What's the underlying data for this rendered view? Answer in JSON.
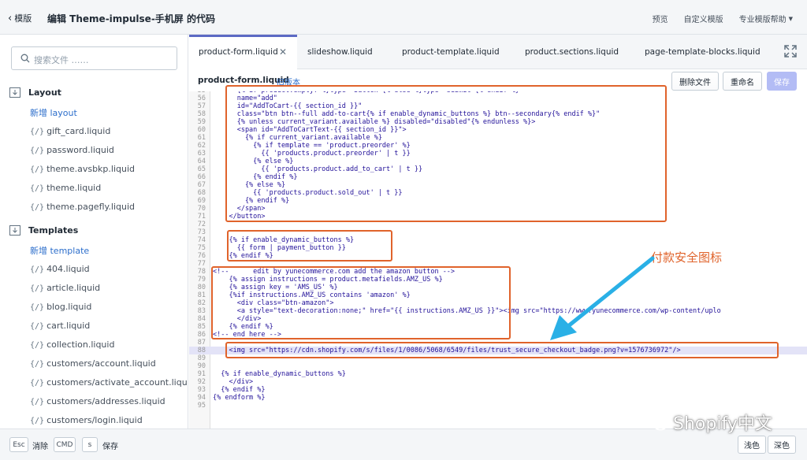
{
  "topbar": {
    "back_label": "模版",
    "title": "编辑 Theme-impulse-手机屏 的代码",
    "nav": [
      "预览",
      "自定义模版",
      "专业模版帮助"
    ]
  },
  "sidebar": {
    "search_placeholder": "搜索文件 ……",
    "layout": {
      "heading": "Layout",
      "new_label": "新增 layout",
      "files": [
        "gift_card.liquid",
        "password.liquid",
        "theme.avsbkp.liquid",
        "theme.liquid",
        "theme.pagefly.liquid"
      ]
    },
    "templates": {
      "heading": "Templates",
      "new_label": "新增 template",
      "files": [
        "404.liquid",
        "article.liquid",
        "blog.liquid",
        "cart.liquid",
        "collection.liquid",
        "customers/account.liquid",
        "customers/activate_account.liquid",
        "customers/addresses.liquid",
        "customers/login.liquid"
      ]
    },
    "file_prefix": "{/}"
  },
  "tabs": [
    "product-form.liquid",
    "slideshow.liquid",
    "product-template.liquid",
    "product.sections.liquid",
    "page-template-blocks.liquid"
  ],
  "file_header": {
    "name": "product-form.liquid",
    "old_version": "旧版本",
    "delete_label": "删除文件",
    "rename_label": "重命名",
    "save_label": "保存"
  },
  "code_lines": [
    {
      "n": "55",
      "t": "      {% if product.empty? %}type=\"button\"{% else %}type=\"submit\"{% endif %}"
    },
    {
      "n": "56",
      "t": "      name=\"add\""
    },
    {
      "n": "57",
      "t": "      id=\"AddToCart-{{ section_id }}\""
    },
    {
      "n": "58",
      "t": "      class=\"btn btn--full add-to-cart{% if enable_dynamic_buttons %} btn--secondary{% endif %}\""
    },
    {
      "n": "59",
      "t": "      {% unless current_variant.available %} disabled=\"disabled\"{% endunless %}>"
    },
    {
      "n": "60",
      "t": "      <span id=\"AddToCartText-{{ section_id }}\">"
    },
    {
      "n": "61",
      "t": "        {% if current_variant.available %}"
    },
    {
      "n": "62",
      "t": "          {% if template == 'product.preorder' %}"
    },
    {
      "n": "63",
      "t": "            {{ 'products.product.preorder' | t }}"
    },
    {
      "n": "64",
      "t": "          {% else %}"
    },
    {
      "n": "65",
      "t": "            {{ 'products.product.add_to_cart' | t }}"
    },
    {
      "n": "66",
      "t": "          {% endif %}"
    },
    {
      "n": "67",
      "t": "        {% else %}"
    },
    {
      "n": "68",
      "t": "          {{ 'products.product.sold_out' | t }}"
    },
    {
      "n": "69",
      "t": "        {% endif %}"
    },
    {
      "n": "70",
      "t": "      </span>"
    },
    {
      "n": "71",
      "t": "    </button>"
    },
    {
      "n": "72",
      "t": ""
    },
    {
      "n": "73",
      "t": ""
    },
    {
      "n": "74",
      "t": "    {% if enable_dynamic_buttons %}"
    },
    {
      "n": "75",
      "t": "      {{ form | payment_button }}"
    },
    {
      "n": "76",
      "t": "    {% endif %}"
    },
    {
      "n": "77",
      "t": ""
    },
    {
      "n": "78",
      "t": "<!--      edit by yunecommerce.com add the amazon button -->"
    },
    {
      "n": "79",
      "t": "    {% assign instructions = product.metafields.AMZ_US %}"
    },
    {
      "n": "80",
      "t": "    {% assign key = 'AMS_US' %}"
    },
    {
      "n": "81",
      "t": "    {%if instructions.AMZ_US contains 'amazon' %}"
    },
    {
      "n": "82",
      "t": "      <div class=\"btn-amazon\">"
    },
    {
      "n": "83",
      "t": "      <a style=\"text-decoration:none;\" href=\"{{ instructions.AMZ_US }}\"><img src=\"https://www.yunecommerce.com/wp-content/uplo"
    },
    {
      "n": "84",
      "t": "      </div>"
    },
    {
      "n": "85",
      "t": "    {% endif %}"
    },
    {
      "n": "86",
      "t": "<!-- end here -->"
    },
    {
      "n": "87",
      "t": ""
    },
    {
      "n": "88",
      "t": "    <img src=\"https://cdn.shopify.com/s/files/1/0086/5068/6549/files/trust_secure_checkout_badge.png?v=1576736972\"/>"
    },
    {
      "n": "89",
      "t": ""
    },
    {
      "n": "90",
      "t": ""
    },
    {
      "n": "91",
      "t": "  {% if enable_dynamic_buttons %}"
    },
    {
      "n": "92",
      "t": "    </div>"
    },
    {
      "n": "93",
      "t": "  {% endif %}"
    },
    {
      "n": "94",
      "t": "{% endform %}"
    },
    {
      "n": "95",
      "t": ""
    }
  ],
  "annotation": {
    "label": "付款安全图标",
    "color": "#e0632b",
    "arrow_color": "#2ab0e6"
  },
  "bottombar": {
    "esc_key": "Esc",
    "esc_label": "消除",
    "cmd_key": "CMD",
    "s_key": "s",
    "save_label": "保存",
    "light_label": "浅色",
    "dark_label": "深色"
  },
  "watermark": "Shopify中文",
  "colors": {
    "accent": "#5c6ac4",
    "link": "#2c6ecb",
    "highlight_line": "#e3e3f7"
  }
}
